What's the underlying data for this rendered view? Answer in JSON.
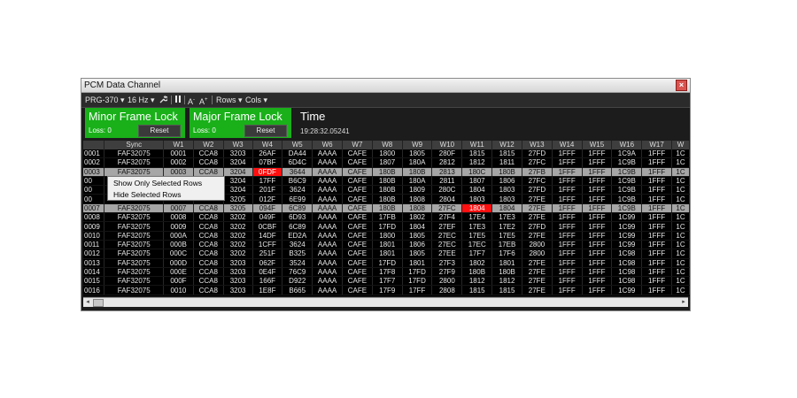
{
  "window": {
    "title": "PCM Data Channel",
    "close_glyph": "×"
  },
  "toolbar": {
    "stream": "PRG-370",
    "rate": "16 Hz",
    "font_smaller": "A",
    "font_larger": "A",
    "rows_menu": "Rows",
    "cols_menu": "Cols"
  },
  "minor": {
    "title": "Minor Frame Lock",
    "loss": "Loss: 0",
    "reset": "Reset"
  },
  "major": {
    "title": "Major Frame Lock",
    "loss": "Loss: 0",
    "reset": "Reset"
  },
  "time": {
    "label": "Time",
    "value": "19:28:32.05241"
  },
  "colors": {
    "lock_green": "#19b019",
    "alert_red": "#ff1010",
    "selected_row": "#a6a6a6"
  },
  "grid": {
    "columns": [
      "",
      "Sync",
      "W1",
      "W2",
      "W3",
      "W4",
      "W5",
      "W6",
      "W7",
      "W8",
      "W9",
      "W10",
      "W11",
      "W12",
      "W13",
      "W14",
      "W15",
      "W16",
      "W17",
      "W"
    ],
    "rows": [
      [
        "0001",
        "FAF32075",
        "0001",
        "CCA8",
        "3203",
        "26AF",
        "DA44",
        "AAAA",
        "CAFE",
        "1800",
        "1805",
        "280F",
        "1815",
        "1815",
        "27FD",
        "1FFF",
        "1FFF",
        "1C9A",
        "1FFF",
        "1C"
      ],
      [
        "0002",
        "FAF32075",
        "0002",
        "CCA8",
        "3204",
        "07BF",
        "6D4C",
        "AAAA",
        "CAFE",
        "1807",
        "180A",
        "2812",
        "1812",
        "1811",
        "27FC",
        "1FFF",
        "1FFF",
        "1C9B",
        "1FFF",
        "1C"
      ],
      [
        "0003",
        "FAF32075",
        "0003",
        "CCA8",
        "3204",
        "0FDF",
        "3644",
        "AAAA",
        "CAFE",
        "180B",
        "180B",
        "2813",
        "180C",
        "180B",
        "27FB",
        "1FFF",
        "1FFF",
        "1C9B",
        "1FFF",
        "1C"
      ],
      [
        "00",
        "",
        "",
        "",
        "3204",
        "17FF",
        "B6C9",
        "AAAA",
        "CAFE",
        "180B",
        "180A",
        "2811",
        "1807",
        "1806",
        "27FC",
        "1FFF",
        "1FFF",
        "1C9B",
        "1FFF",
        "1C"
      ],
      [
        "00",
        "",
        "",
        "",
        "3204",
        "201F",
        "3624",
        "AAAA",
        "CAFE",
        "180B",
        "1809",
        "280C",
        "1804",
        "1803",
        "27FD",
        "1FFF",
        "1FFF",
        "1C9B",
        "1FFF",
        "1C"
      ],
      [
        "00",
        "",
        "",
        "",
        "3205",
        "012F",
        "6E99",
        "AAAA",
        "CAFE",
        "180B",
        "1808",
        "2804",
        "1803",
        "1803",
        "27FE",
        "1FFF",
        "1FFF",
        "1C9B",
        "1FFF",
        "1C"
      ],
      [
        "0007",
        "FAF32075",
        "0007",
        "CCA8",
        "3205",
        "094F",
        "6C89",
        "AAAA",
        "CAFE",
        "180B",
        "1808",
        "27FC",
        "1804",
        "1804",
        "27FE",
        "1FFF",
        "1FFF",
        "1C9B",
        "1FFF",
        "1C"
      ],
      [
        "0008",
        "FAF32075",
        "0008",
        "CCA8",
        "3202",
        "049F",
        "6D93",
        "AAAA",
        "CAFE",
        "17FB",
        "1802",
        "27F4",
        "17E4",
        "17E3",
        "27FE",
        "1FFF",
        "1FFF",
        "1C99",
        "1FFF",
        "1C"
      ],
      [
        "0009",
        "FAF32075",
        "0009",
        "CCA8",
        "3202",
        "0CBF",
        "6C89",
        "AAAA",
        "CAFE",
        "17FD",
        "1804",
        "27EF",
        "17E3",
        "17E2",
        "27FD",
        "1FFF",
        "1FFF",
        "1C99",
        "1FFF",
        "1C"
      ],
      [
        "0010",
        "FAF32075",
        "000A",
        "CCA8",
        "3202",
        "14DF",
        "ED2A",
        "AAAA",
        "CAFE",
        "1800",
        "1805",
        "27EC",
        "17E5",
        "17E5",
        "27FE",
        "1FFF",
        "1FFF",
        "1C99",
        "1FFF",
        "1C"
      ],
      [
        "0011",
        "FAF32075",
        "000B",
        "CCA8",
        "3202",
        "1CFF",
        "3624",
        "AAAA",
        "CAFE",
        "1801",
        "1806",
        "27EC",
        "17EC",
        "17EB",
        "2800",
        "1FFF",
        "1FFF",
        "1C99",
        "1FFF",
        "1C"
      ],
      [
        "0012",
        "FAF32075",
        "000C",
        "CCA8",
        "3202",
        "251F",
        "B325",
        "AAAA",
        "CAFE",
        "1801",
        "1805",
        "27EE",
        "17F7",
        "17F6",
        "2800",
        "1FFF",
        "1FFF",
        "1C98",
        "1FFF",
        "1C"
      ],
      [
        "0013",
        "FAF32075",
        "000D",
        "CCA8",
        "3203",
        "062F",
        "3524",
        "AAAA",
        "CAFE",
        "17FD",
        "1801",
        "27F3",
        "1802",
        "1801",
        "27FE",
        "1FFF",
        "1FFF",
        "1C98",
        "1FFF",
        "1C"
      ],
      [
        "0014",
        "FAF32075",
        "000E",
        "CCA8",
        "3203",
        "0E4F",
        "76C9",
        "AAAA",
        "CAFE",
        "17F8",
        "17FD",
        "27F9",
        "180B",
        "180B",
        "27FE",
        "1FFF",
        "1FFF",
        "1C98",
        "1FFF",
        "1C"
      ],
      [
        "0015",
        "FAF32075",
        "000F",
        "CCA8",
        "3203",
        "166F",
        "D922",
        "AAAA",
        "CAFE",
        "17F7",
        "17FD",
        "2800",
        "1812",
        "1812",
        "27FE",
        "1FFF",
        "1FFF",
        "1C98",
        "1FFF",
        "1C"
      ],
      [
        "0016",
        "FAF32075",
        "0010",
        "CCA8",
        "3203",
        "1E8F",
        "B665",
        "AAAA",
        "CAFE",
        "17F9",
        "17FF",
        "2808",
        "1815",
        "1815",
        "27FE",
        "1FFF",
        "1FFF",
        "1C99",
        "1FFF",
        "1C"
      ]
    ],
    "selected_rows": [
      2,
      6
    ],
    "alert_cells": [
      [
        2,
        5
      ],
      [
        6,
        12
      ]
    ]
  },
  "context_menu": {
    "items": [
      "Show Only Selected Rows",
      "Hide Selected Rows"
    ]
  },
  "scrollbar": {
    "left_arrow": "◂",
    "right_arrow": "▸"
  }
}
